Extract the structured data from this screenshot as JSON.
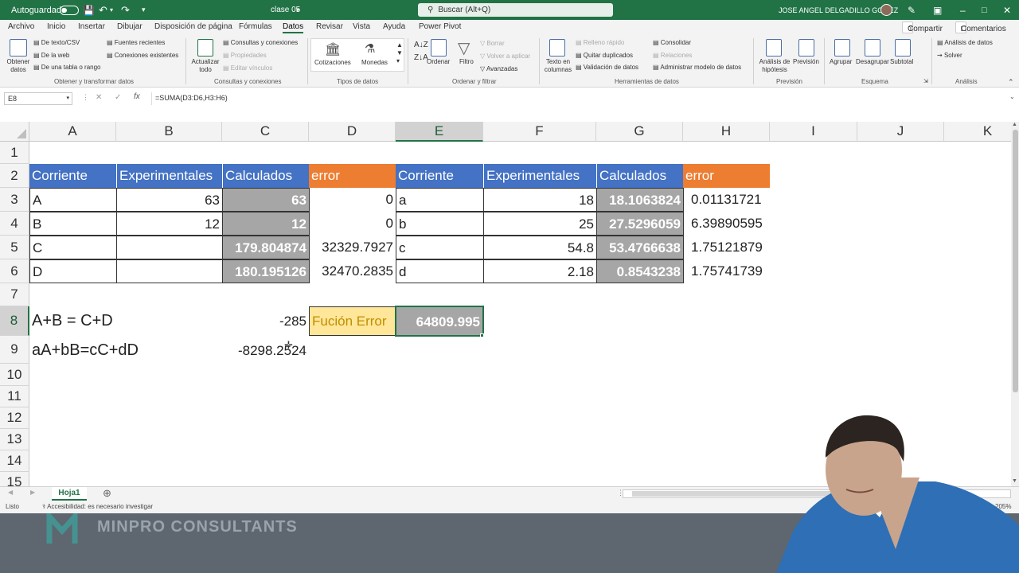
{
  "titlebar": {
    "autosave_label": "Autoguardado",
    "filename": "clase 05",
    "search_placeholder": "Buscar (Alt+Q)",
    "user_name": "JOSE ANGEL DELGADILLO GOMEZ"
  },
  "menu": {
    "tabs": [
      "Archivo",
      "Inicio",
      "Insertar",
      "Dibujar",
      "Disposición de página",
      "Fórmulas",
      "Datos",
      "Revisar",
      "Vista",
      "Ayuda",
      "Power Pivot"
    ],
    "active_tab": "Datos",
    "share": "Compartir",
    "comments": "Comentarios"
  },
  "ribbon": {
    "obtener_datos": "Obtener datos",
    "de_texto": "De texto/CSV",
    "de_web": "De la web",
    "de_tabla": "De una tabla o rango",
    "fuentes_recientes": "Fuentes recientes",
    "conexiones_existentes": "Conexiones existentes",
    "group_obtener": "Obtener y transformar datos",
    "actualizar_todo": "Actualizar todo",
    "consultas_conexiones": "Consultas y conexiones",
    "propiedades": "Propiedades",
    "editar_vinculos": "Editar vínculos",
    "group_consultas": "Consultas y conexiones",
    "cotizaciones": "Cotizaciones",
    "monedas": "Monedas",
    "group_tipos": "Tipos de datos",
    "ordenar": "Ordenar",
    "filtro": "Filtro",
    "borrar": "Borrar",
    "volver_aplicar": "Volver a aplicar",
    "avanzadas": "Avanzadas",
    "group_ordenar": "Ordenar y filtrar",
    "texto_columnas": "Texto en columnas",
    "relleno_rapido": "Relleno rápido",
    "quitar_duplicados": "Quitar duplicados",
    "validacion": "Validación de datos",
    "consolidar": "Consolidar",
    "relaciones": "Relaciones",
    "administrar_modelo": "Administrar modelo de datos",
    "group_herramientas": "Herramientas de datos",
    "analisis_hipotesis": "Análisis de hipótesis",
    "prevision": "Previsión",
    "group_prevision": "Previsión",
    "agrupar": "Agrupar",
    "desagrupar": "Desagrupar",
    "subtotal": "Subtotal",
    "group_esquema": "Esquema",
    "analisis_datos": "Análisis de datos",
    "solver": "Solver",
    "group_analisis": "Análisis"
  },
  "formula_bar": {
    "name_box": "E8",
    "formula": "=SUMA(D3:D6,H3:H6)"
  },
  "columns": [
    "A",
    "B",
    "C",
    "D",
    "E",
    "F",
    "G",
    "H",
    "I",
    "J",
    "K"
  ],
  "rows": [
    "1",
    "2",
    "3",
    "4",
    "5",
    "6",
    "7",
    "8",
    "9",
    "10",
    "11",
    "12",
    "13",
    "14",
    "15"
  ],
  "table1": {
    "headers": [
      "Corriente",
      "Experimentales",
      "Calculados",
      "error"
    ],
    "rows": [
      [
        "A",
        "63",
        "63",
        "0"
      ],
      [
        "B",
        "12",
        "12",
        "0"
      ],
      [
        "C",
        "",
        "179.804874",
        "32329.7927"
      ],
      [
        "D",
        "",
        "180.195126",
        "32470.2835"
      ]
    ]
  },
  "table2": {
    "headers": [
      "Corriente",
      "Experimentales",
      "Calculados",
      "error"
    ],
    "rows": [
      [
        "a",
        "18",
        "18.1063824",
        "0.01131721"
      ],
      [
        "b",
        "25",
        "27.5296059",
        "6.39890595"
      ],
      [
        "c",
        "54.8",
        "53.4766638",
        "1.75121879"
      ],
      [
        "d",
        "2.18",
        "0.8543238",
        "1.75741739"
      ]
    ]
  },
  "equations": {
    "eq1_label": "A+B = C+D",
    "eq1_value": "-285",
    "eq2_label": "aA+bB=cC+dD",
    "eq2_value": "-8298.2524",
    "error_label": "Fución Error",
    "error_value": "64809.995"
  },
  "sheet_tab": "Hoja1",
  "status": {
    "ready": "Listo",
    "accessibility": "Accesibilidad: es necesario investigar",
    "zoom": "205%"
  },
  "watermark": "MINPRO CONSULTANTS",
  "colors": {
    "excel_green": "#217346",
    "header_blue": "#4472c4",
    "header_orange": "#ed7d31",
    "calc_gray": "#a6a6a6",
    "yellow_fill": "#ffe699"
  }
}
